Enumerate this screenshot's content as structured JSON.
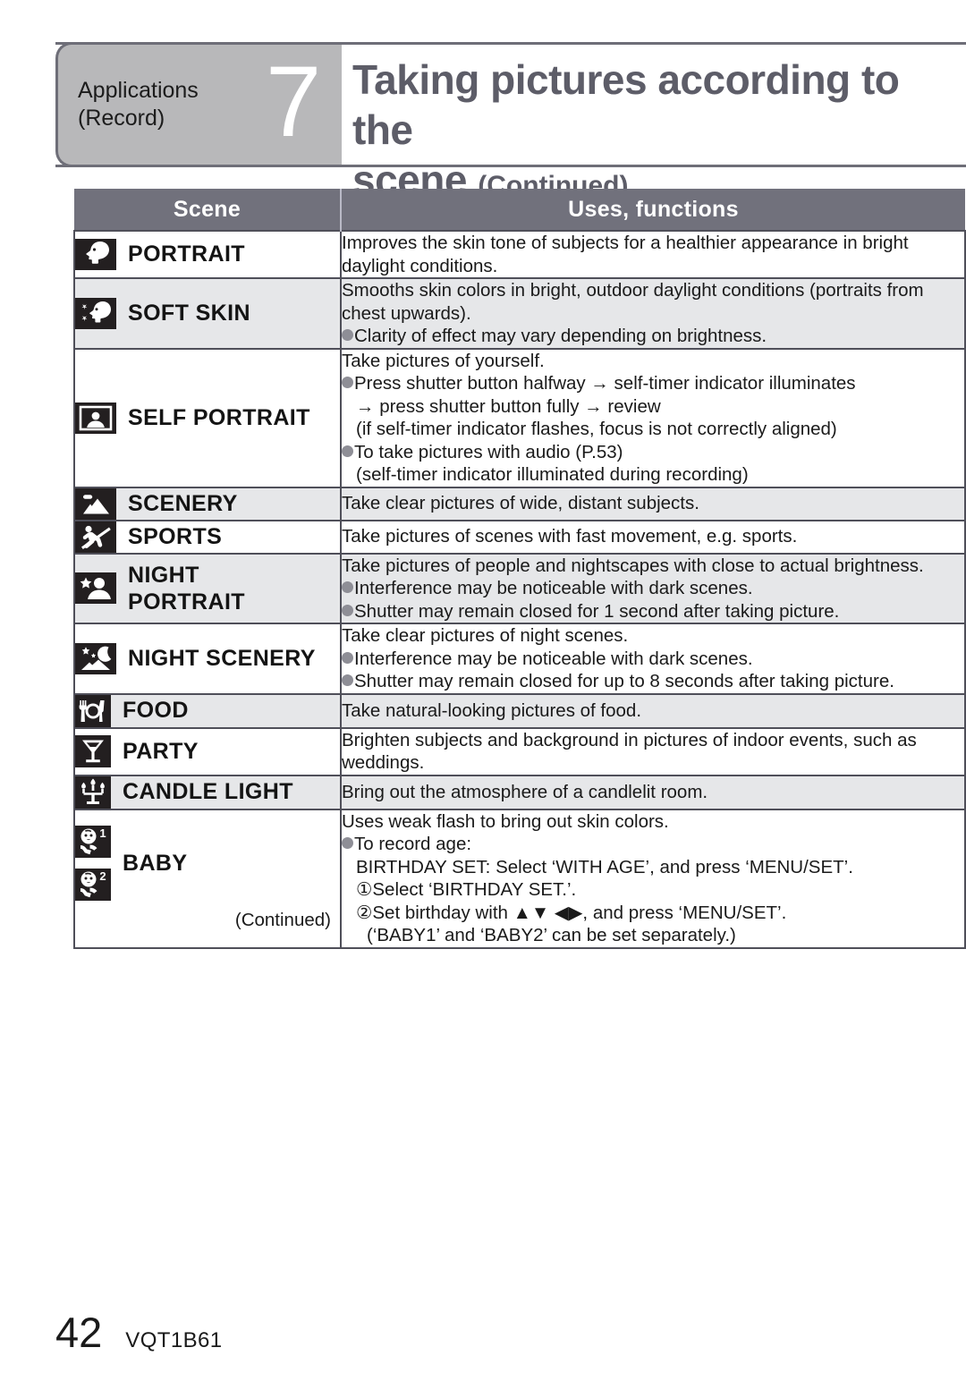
{
  "header": {
    "chapter_label_line1": "Applications",
    "chapter_label_line2": "(Record)",
    "chapter_number": "7",
    "title_line1": "Taking pictures according to the",
    "title_line2_main": "scene",
    "title_line2_note": "(Continued)"
  },
  "table": {
    "columns": {
      "scene": "Scene",
      "uses": "Uses, functions"
    },
    "rows": [
      {
        "icon": "portrait-icon",
        "name": "PORTRAIT",
        "shaded": false,
        "lines": [
          {
            "text": "Improves the skin tone of subjects for a healthier appearance in bright",
            "style": "plain"
          },
          {
            "text": "daylight conditions.",
            "style": "plain"
          }
        ]
      },
      {
        "icon": "soft-skin-icon",
        "name": "SOFT SKIN",
        "shaded": true,
        "lines": [
          {
            "text": "Smooths skin colors in bright, outdoor daylight conditions (portraits from",
            "style": "plain"
          },
          {
            "text": "chest upwards).",
            "style": "plain"
          },
          {
            "text": "Clarity of effect may vary depending on brightness.",
            "style": "bullet"
          }
        ]
      },
      {
        "icon": "self-portrait-icon",
        "name": "SELF PORTRAIT",
        "shaded": false,
        "lines": [
          {
            "text": "Take pictures of yourself.",
            "style": "plain"
          },
          {
            "text": "Press shutter button halfway → self-timer indicator illuminates",
            "style": "bullet"
          },
          {
            "text": "→ press shutter button fully → review",
            "style": "indent1"
          },
          {
            "text": "(if self-timer indicator flashes, focus is not correctly aligned)",
            "style": "indent1"
          },
          {
            "text": "To take pictures with audio (P.53)",
            "style": "bullet"
          },
          {
            "text": "(self-timer indicator illuminated during recording)",
            "style": "indent1"
          }
        ]
      },
      {
        "icon": "scenery-icon",
        "name": "SCENERY",
        "shaded": true,
        "lines": [
          {
            "text": "Take clear pictures of wide, distant subjects.",
            "style": "plain"
          }
        ]
      },
      {
        "icon": "sports-icon",
        "name": "SPORTS",
        "shaded": false,
        "lines": [
          {
            "text": "Take pictures of scenes with fast movement, e.g. sports.",
            "style": "plain"
          }
        ]
      },
      {
        "icon": "night-portrait-icon",
        "name": "NIGHT\nPORTRAIT",
        "shaded": true,
        "lines": [
          {
            "text": "Take pictures of people and nightscapes with close to actual brightness.",
            "style": "plain"
          },
          {
            "text": "Interference may be noticeable with dark scenes.",
            "style": "bullet"
          },
          {
            "text": "Shutter may remain closed for 1 second after taking picture.",
            "style": "bullet"
          }
        ]
      },
      {
        "icon": "night-scenery-icon",
        "name": "NIGHT SCENERY",
        "shaded": false,
        "lines": [
          {
            "text": "Take clear pictures of night scenes.",
            "style": "plain"
          },
          {
            "text": "Interference may be noticeable with dark scenes.",
            "style": "bullet"
          },
          {
            "text": "Shutter may remain closed for up to 8 seconds after taking picture.",
            "style": "bullet"
          }
        ]
      },
      {
        "icon": "food-icon",
        "name": "FOOD",
        "shaded": true,
        "lines": [
          {
            "text": "Take natural-looking pictures of food.",
            "style": "plain"
          }
        ]
      },
      {
        "icon": "party-icon",
        "name": "PARTY",
        "shaded": false,
        "lines": [
          {
            "text": "Brighten subjects and background in pictures of indoor events, such as",
            "style": "plain"
          },
          {
            "text": "weddings.",
            "style": "plain"
          }
        ]
      },
      {
        "icon": "candle-light-icon",
        "name": "CANDLE LIGHT",
        "shaded": true,
        "lines": [
          {
            "text": "Bring out the atmosphere of a candlelit room.",
            "style": "plain"
          }
        ]
      },
      {
        "icon": "baby-icon",
        "name": "BABY",
        "shaded": false,
        "continued_note": "(Continued)",
        "lines": [
          {
            "text": "Uses weak flash to bring out skin colors.",
            "style": "plain"
          },
          {
            "text": "To record age:",
            "style": "bullet"
          },
          {
            "text": "BIRTHDAY SET: Select ‘WITH AGE’, and press ‘MENU/SET’.",
            "style": "indent1"
          },
          {
            "text": "①Select ‘BIRTHDAY SET.’.",
            "style": "indent1"
          },
          {
            "text": "②Set birthday with ▲▼ ◀▶, and press ‘MENU/SET’.",
            "style": "indent1"
          },
          {
            "text": "(‘BABY1’ and ‘BABY2’ can be set separately.)",
            "style": "indent2"
          }
        ]
      }
    ]
  },
  "footer": {
    "page_number": "42",
    "document_code": "VQT1B61"
  },
  "colors": {
    "header_gray": "#b8b8ba",
    "rule_gray": "#6e6e78",
    "title_gray": "#5d5d68",
    "table_header_bg": "#71717c",
    "row_shaded_bg": "#e6e7e9",
    "border": "#4f4f59",
    "icon_bg": "#231f20",
    "bullet": "#8e8e96"
  }
}
